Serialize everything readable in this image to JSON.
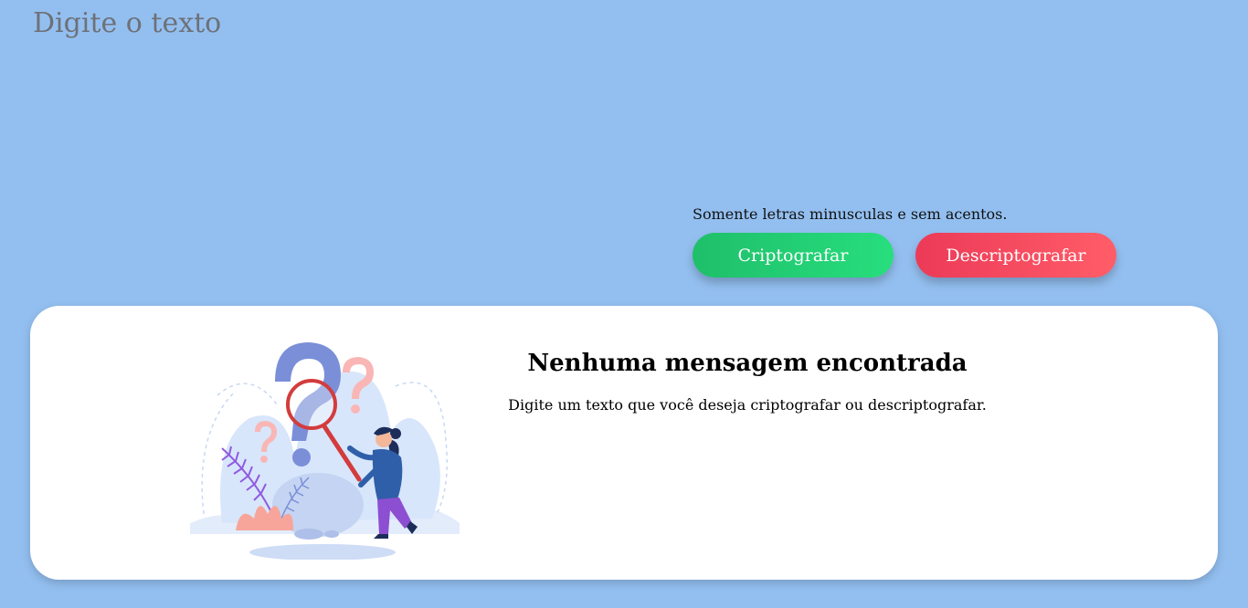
{
  "input": {
    "placeholder": "Digite o texto",
    "value": ""
  },
  "hint": "Somente letras minusculas e sem acentos.",
  "buttons": {
    "encrypt_label": "Criptografar",
    "decrypt_label": "Descriptografar"
  },
  "output": {
    "title": "Nenhuma mensagem encontrada",
    "subtitle": "Digite um texto que você deseja criptografar ou descriptografar.",
    "illustration_icon": "person-searching-question-marks-icon"
  },
  "colors": {
    "background": "#93bff0",
    "encrypt_button": "#23cf74",
    "decrypt_button": "#f24a5e",
    "card": "#ffffff"
  }
}
